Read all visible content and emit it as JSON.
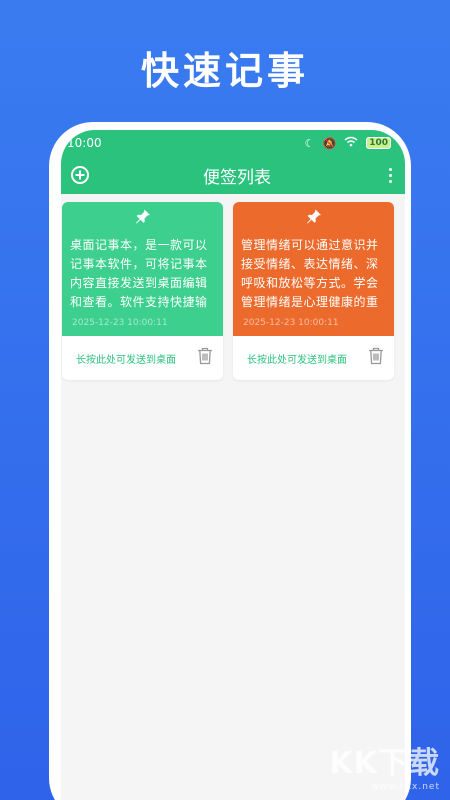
{
  "hero": {
    "title": "快速记事"
  },
  "statusbar": {
    "time": "10:00",
    "battery": "100"
  },
  "toolbar": {
    "title": "便签列表"
  },
  "colors": {
    "accent": "#2bc27e",
    "note_green": "#3ccf8e",
    "note_orange": "#ec6a2c",
    "background": "#2f63ea"
  },
  "notes": [
    {
      "color": "#3ccf8e",
      "text": "桌面记事本，是一款可以记事本软件，可将记事本内容直接发送到桌面编辑和查看。软件支持快捷输入、设",
      "date": "2025-12-23 10:00:11",
      "send_label": "长按此处可发送到桌面"
    },
    {
      "color": "#ec6a2c",
      "text": "管理情绪可以通过意识并接受情绪、表达情绪、深呼吸和放松等方式。学会管理情绪是心理健康的重要组成部",
      "date": "2025-12-23 10:00:11",
      "send_label": "长按此处可发送到桌面"
    }
  ],
  "watermark": {
    "main": "KK下载",
    "sub": "www.kkx.net"
  }
}
